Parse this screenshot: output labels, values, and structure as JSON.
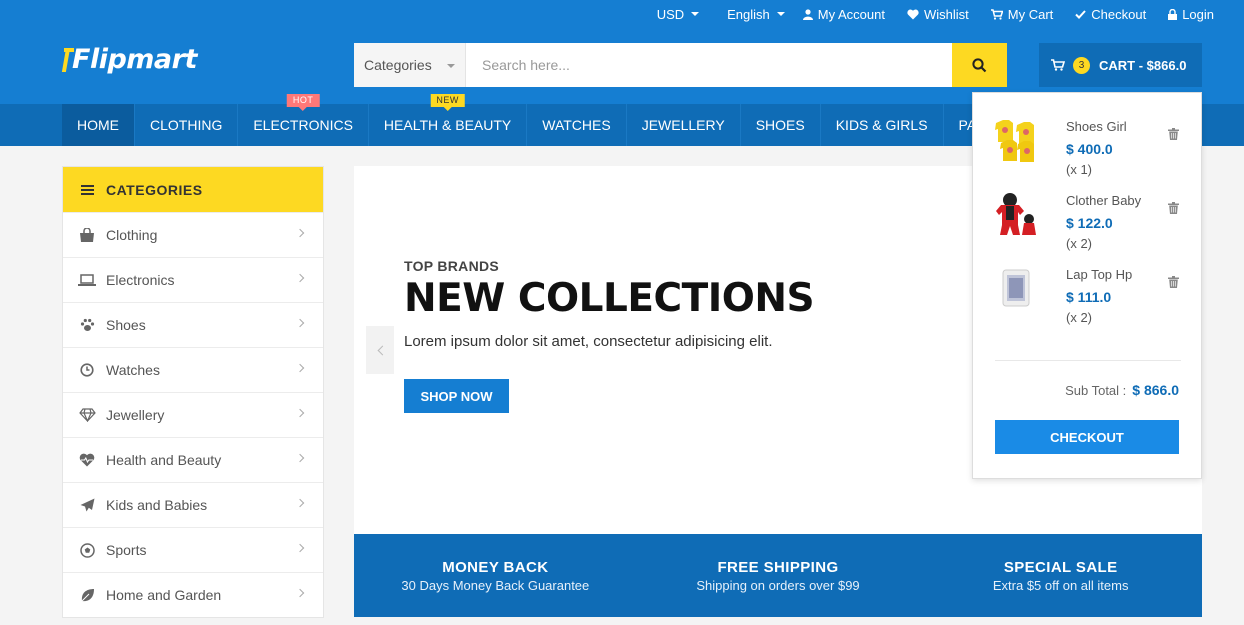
{
  "colors": {
    "primary": "#157ed2",
    "primary_dark": "#0f6cb6",
    "accent": "#fdd922",
    "hot": "#ff7878"
  },
  "topbar": {
    "currency": "USD",
    "language": "English",
    "account": "My Account",
    "wishlist": "Wishlist",
    "cart": "My Cart",
    "checkout": "Checkout",
    "login": "Login"
  },
  "logo": {
    "text": "Flipmart"
  },
  "search": {
    "category": "Categories",
    "placeholder": "Search here..."
  },
  "cart": {
    "count": "3",
    "label": "CART - $866.0"
  },
  "nav": {
    "items": [
      {
        "label": "HOME",
        "active": true
      },
      {
        "label": "CLOTHING"
      },
      {
        "label": "ELECTRONICS",
        "tag": "HOT"
      },
      {
        "label": "HEALTH & BEAUTY",
        "tag": "NEW"
      },
      {
        "label": "WATCHES"
      },
      {
        "label": "JEWELLERY"
      },
      {
        "label": "SHOES"
      },
      {
        "label": "KIDS & GIRLS"
      },
      {
        "label": "PAGES"
      }
    ]
  },
  "sidebar": {
    "title": "CATEGORIES",
    "items": [
      {
        "label": "Clothing",
        "icon": "shopping-bag-icon"
      },
      {
        "label": "Electronics",
        "icon": "laptop-icon"
      },
      {
        "label": "Shoes",
        "icon": "paw-icon"
      },
      {
        "label": "Watches",
        "icon": "clock-icon"
      },
      {
        "label": "Jewellery",
        "icon": "diamond-icon"
      },
      {
        "label": "Health and Beauty",
        "icon": "heartbeat-icon"
      },
      {
        "label": "Kids and Babies",
        "icon": "paper-plane-icon"
      },
      {
        "label": "Sports",
        "icon": "soccer-ball-icon"
      },
      {
        "label": "Home and Garden",
        "icon": "leaf-icon"
      }
    ]
  },
  "hero": {
    "subtitle": "TOP BRANDS",
    "title": "NEW COLLECTIONS",
    "description": "Lorem ipsum dolor sit amet, consectetur adipisicing elit.",
    "button": "SHOP NOW"
  },
  "info": [
    {
      "title": "MONEY BACK",
      "text": "30 Days Money Back Guarantee"
    },
    {
      "title": "FREE SHIPPING",
      "text": "Shipping on orders over $99"
    },
    {
      "title": "SPECIAL SALE",
      "text": "Extra $5 off on all items"
    }
  ],
  "dropdown": {
    "items": [
      {
        "name": "Shoes Girl",
        "price": "$ 400.0",
        "qty": "(x 1)"
      },
      {
        "name": "Clother Baby",
        "price": "$ 122.0",
        "qty": "(x 2)"
      },
      {
        "name": "Lap Top Hp",
        "price": "$ 111.0",
        "qty": "(x 2)"
      }
    ],
    "subtotal_label": "Sub Total :",
    "subtotal_value": "$ 866.0",
    "checkout": "CHECKOUT"
  }
}
